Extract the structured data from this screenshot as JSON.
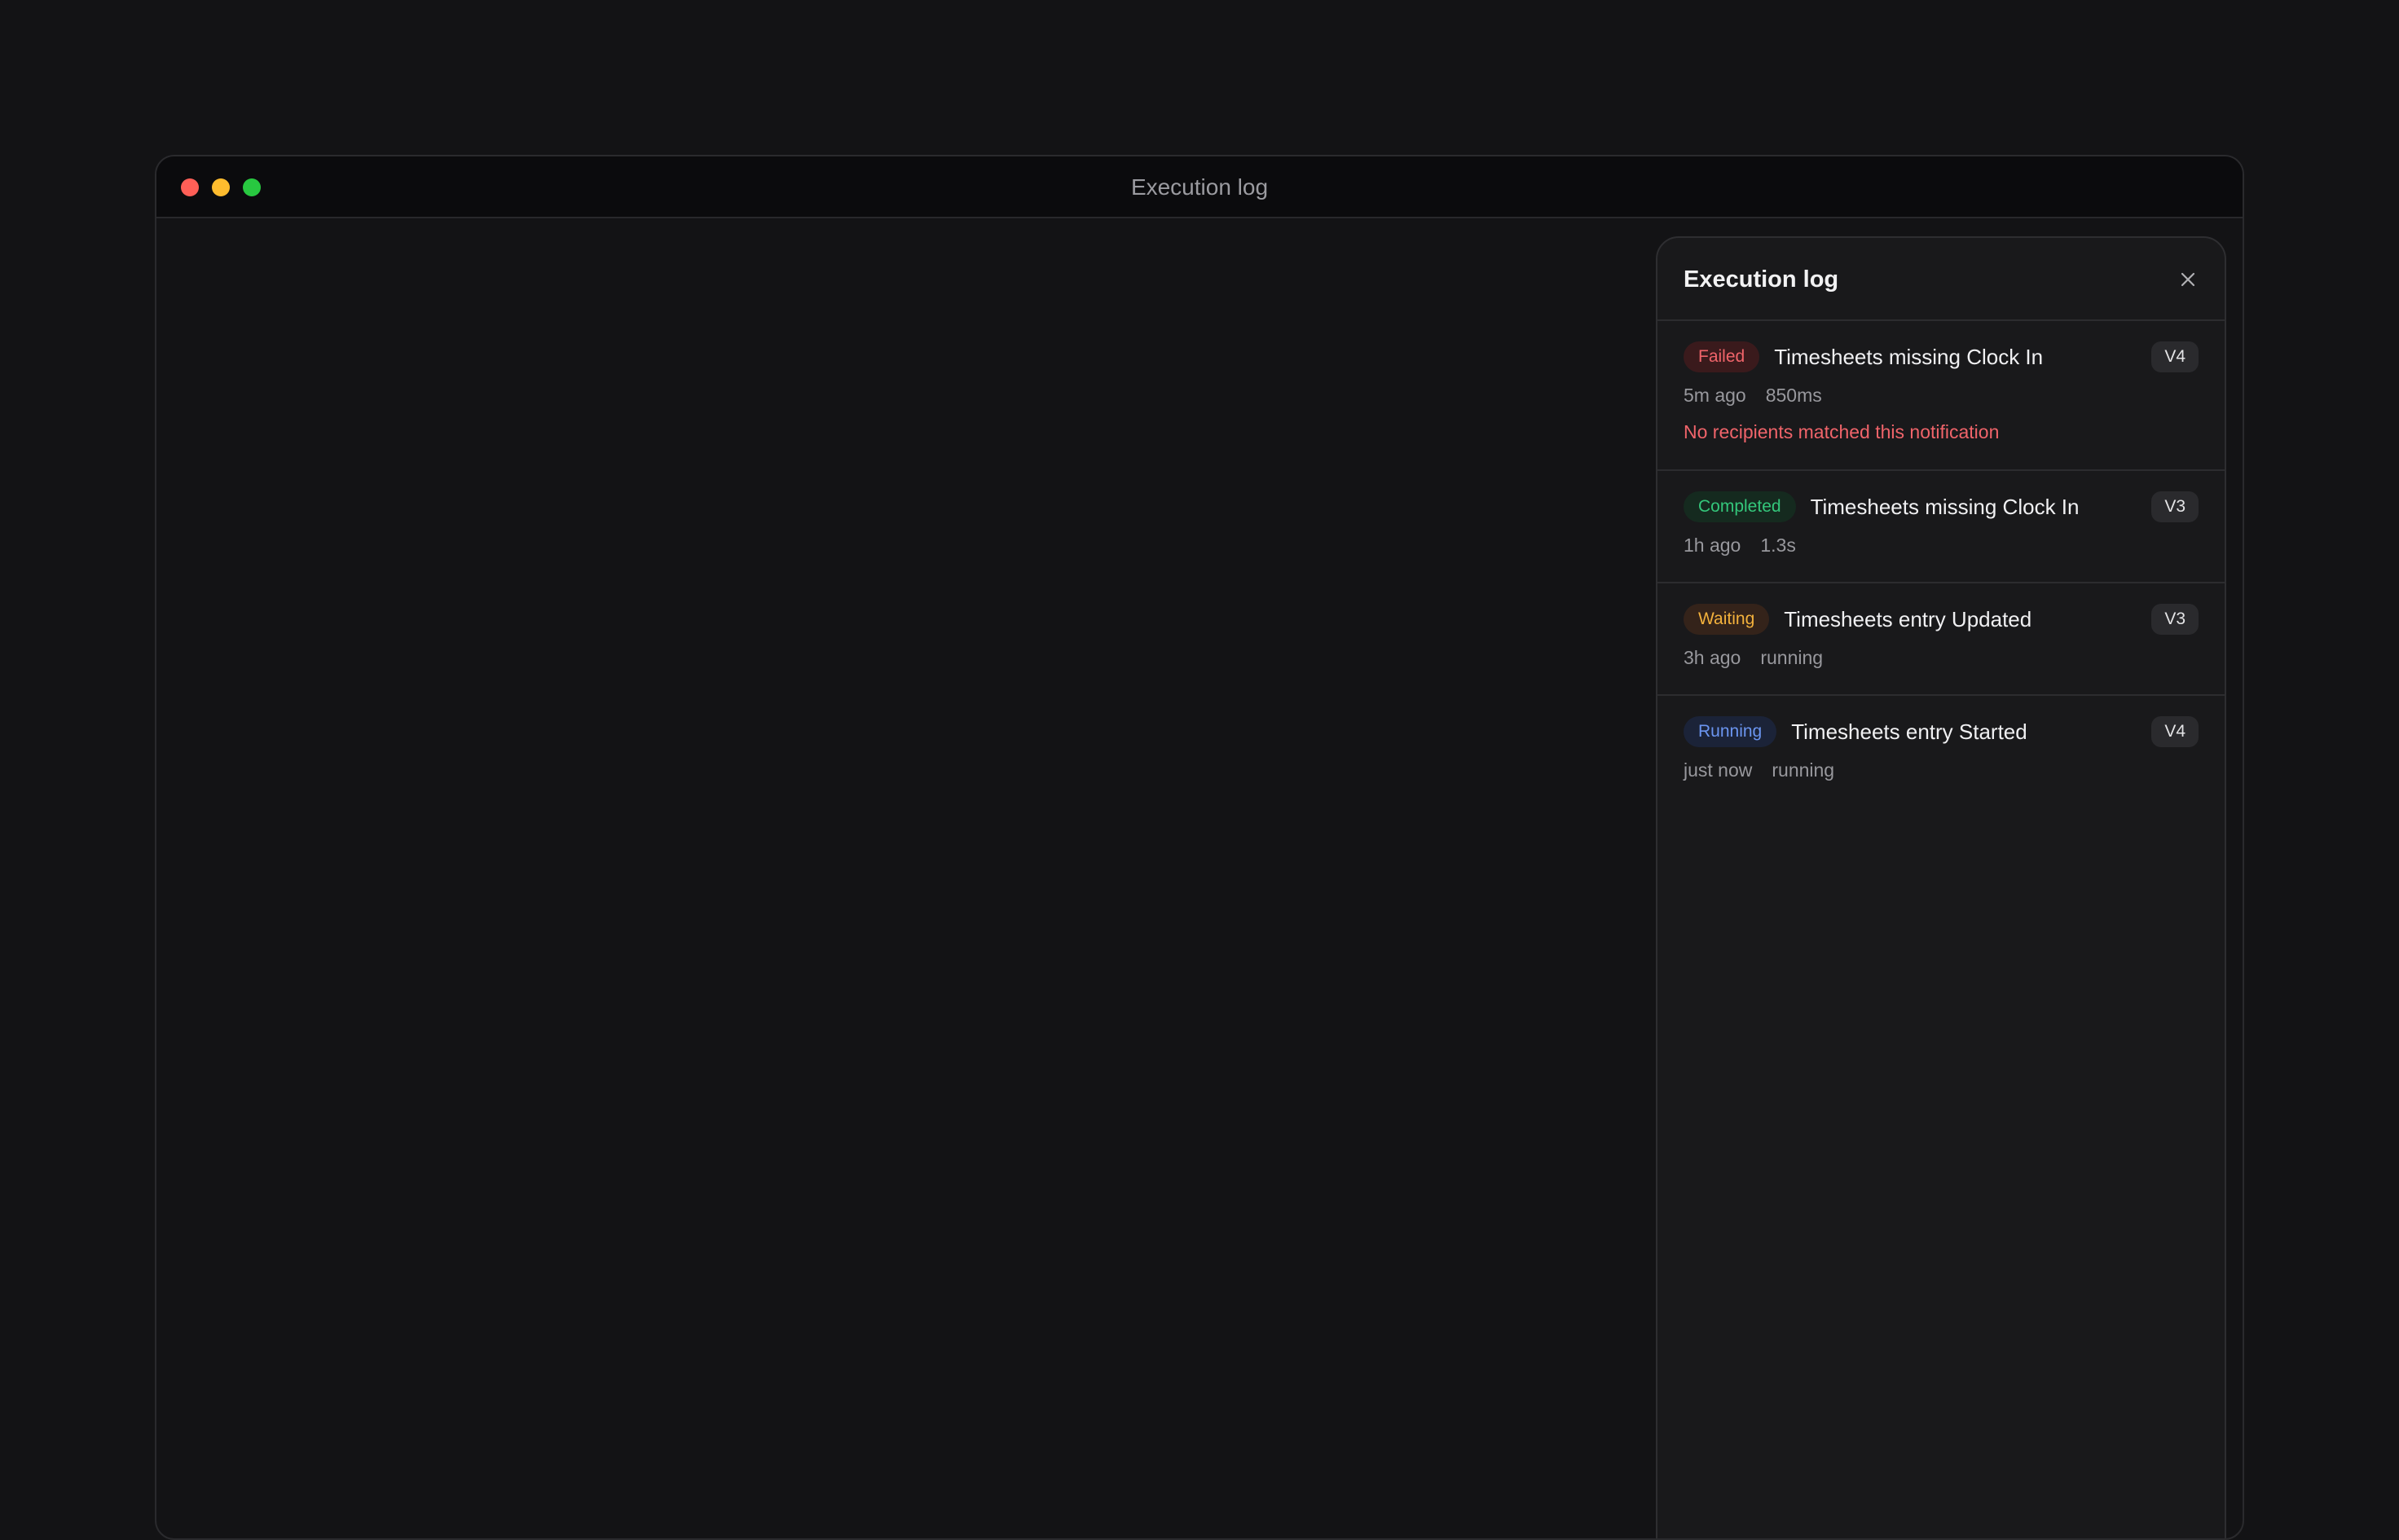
{
  "window": {
    "title": "Execution log"
  },
  "panel": {
    "title": "Execution log",
    "close_icon": "close-icon",
    "items": [
      {
        "status": "Failed",
        "title": "Timesheets missing Clock In",
        "version": "V4",
        "time": "5m ago",
        "duration": "850ms",
        "error": "No recipients matched this notification"
      },
      {
        "status": "Completed",
        "title": "Timesheets missing Clock In",
        "version": "V3",
        "time": "1h ago",
        "duration": "1.3s"
      },
      {
        "status": "Waiting",
        "title": "Timesheets entry Updated",
        "version": "V3",
        "time": "3h ago",
        "duration": "running"
      },
      {
        "status": "Running",
        "title": "Timesheets entry Started",
        "version": "V4",
        "time": "just now",
        "duration": "running"
      }
    ]
  },
  "colors": {
    "failed": "#f0646a",
    "completed": "#34c77b",
    "waiting": "#f3b13c",
    "running": "#6b95f0"
  }
}
